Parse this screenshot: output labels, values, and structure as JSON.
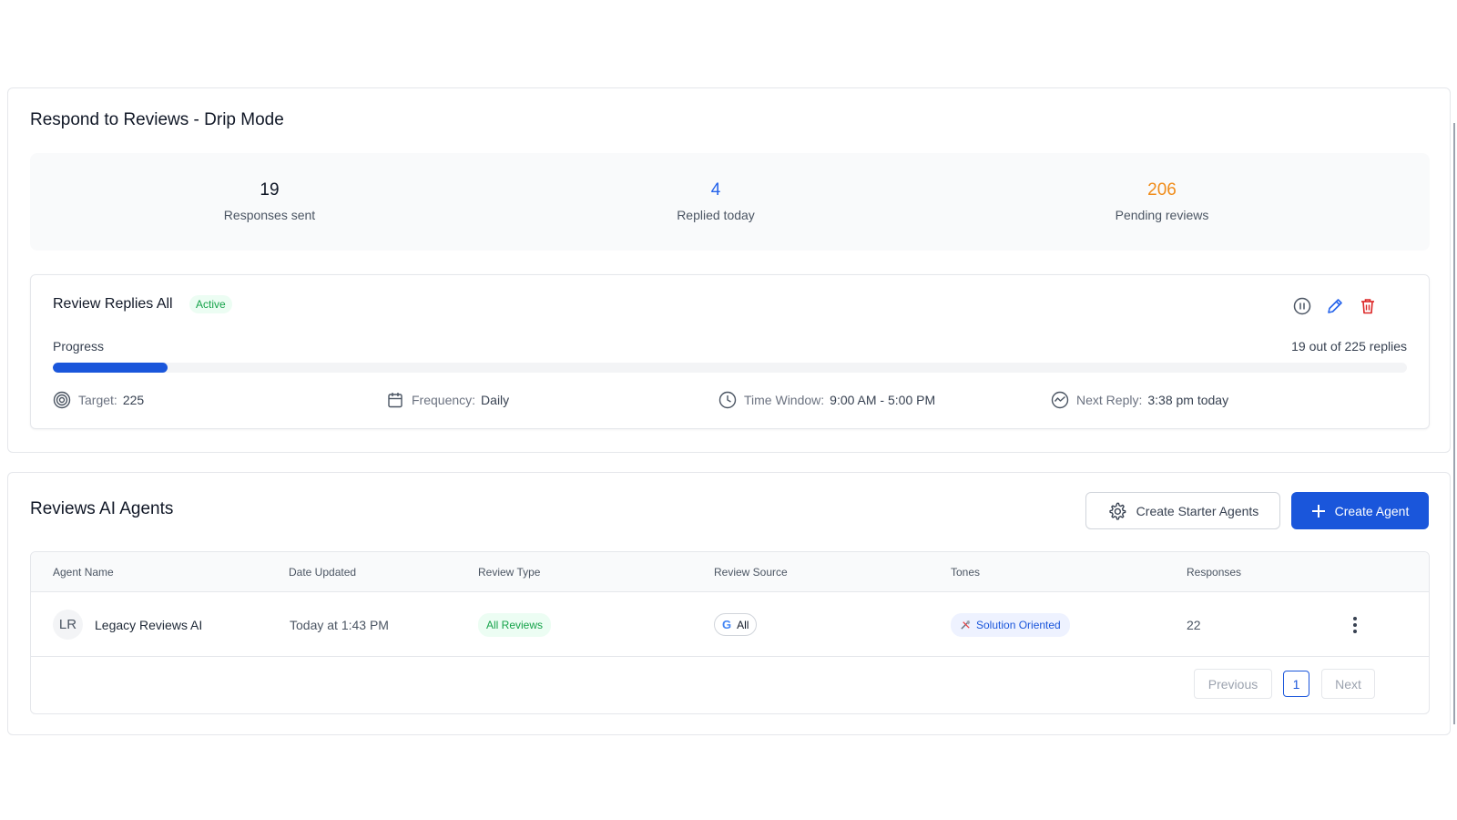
{
  "drip": {
    "title": "Respond to Reviews - Drip Mode",
    "stats": [
      {
        "value": "19",
        "label": "Responses sent",
        "color": "#111827"
      },
      {
        "value": "4",
        "label": "Replied today",
        "color": "#2563eb"
      },
      {
        "value": "206",
        "label": "Pending reviews",
        "color": "#f08c1a"
      }
    ],
    "campaign": {
      "name": "Review Replies All",
      "status": "Active",
      "progress_label": "Progress",
      "progress_count": "19 out of 225 replies",
      "progress_fraction": 0.0844,
      "target_label": "Target:",
      "target_value": "225",
      "frequency_label": "Frequency:",
      "frequency_value": "Daily",
      "time_window_label": "Time Window:",
      "time_window_value": "9:00 AM - 5:00 PM",
      "next_reply_label": "Next Reply:",
      "next_reply_value": "3:38 pm today"
    }
  },
  "agents": {
    "title": "Reviews AI Agents",
    "create_starter_label": "Create Starter Agents",
    "create_agent_label": "Create Agent",
    "columns": [
      "Agent Name",
      "Date Updated",
      "Review Type",
      "Review Source",
      "Tones",
      "Responses"
    ],
    "rows": [
      {
        "initials": "LR",
        "name": "Legacy Reviews AI",
        "date_updated": "Today at 1:43 PM",
        "review_type": "All Reviews",
        "source_icon": "G",
        "source": "All",
        "tone": "Solution Oriented",
        "responses": "22"
      }
    ],
    "pagination": {
      "previous": "Previous",
      "page": "1",
      "next": "Next"
    }
  },
  "colors": {
    "primary": "#1a56db",
    "success": "#16a34a",
    "warning": "#f08c1a",
    "danger": "#dc2626"
  }
}
